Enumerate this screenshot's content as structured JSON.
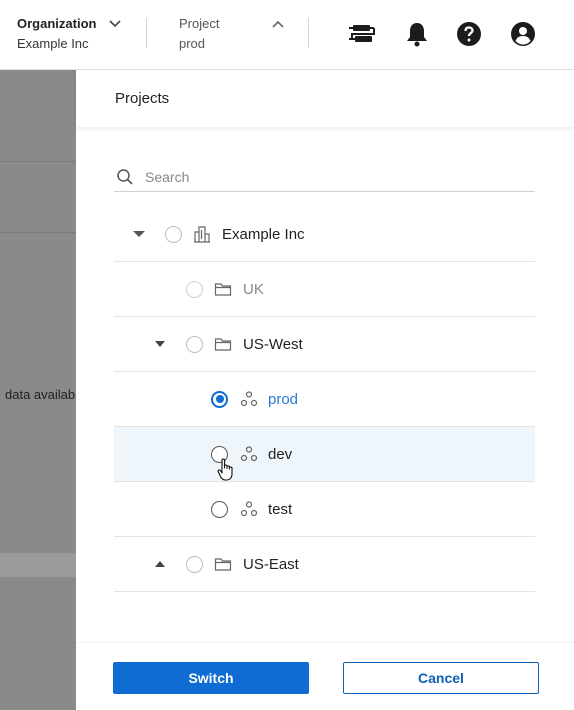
{
  "topbar": {
    "organization": {
      "title": "Organization",
      "value": "Example Inc"
    },
    "project": {
      "title": "Project",
      "value": "prod"
    },
    "icons": [
      "pipeline-icon",
      "bell-icon",
      "help-icon",
      "account-icon"
    ]
  },
  "background": {
    "truncated_text": "data availab"
  },
  "panel": {
    "title": "Projects",
    "search": {
      "placeholder": "Search",
      "value": ""
    },
    "tree": [
      {
        "label": "Example Inc",
        "type": "organization",
        "expanded": true
      },
      {
        "label": "UK",
        "type": "folder",
        "disabled": true
      },
      {
        "label": "US-West",
        "type": "folder",
        "expanded": true
      },
      {
        "label": "prod",
        "type": "project",
        "selected": true
      },
      {
        "label": "dev",
        "type": "project",
        "hovered": true
      },
      {
        "label": "test",
        "type": "project"
      },
      {
        "label": "US-East",
        "type": "folder",
        "expanded": false
      }
    ],
    "buttons": {
      "primary": "Switch",
      "secondary": "Cancel"
    }
  },
  "colors": {
    "accent": "#0f6cd3",
    "hover_row": "#eef6fb",
    "backdrop": "#8a8a8a"
  }
}
